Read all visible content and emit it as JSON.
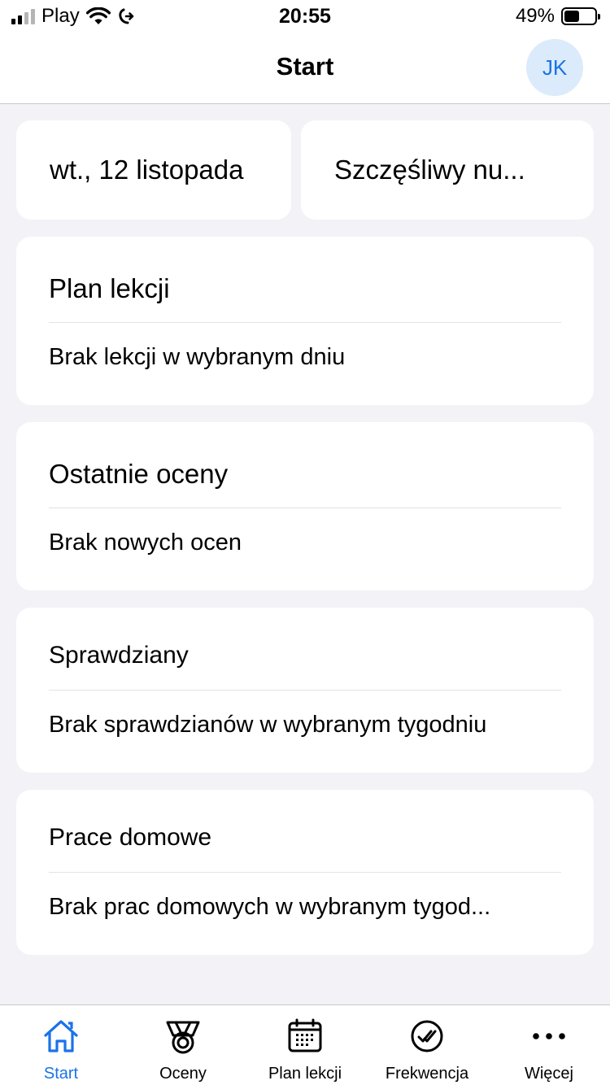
{
  "status_bar": {
    "carrier": "Play",
    "time": "20:55",
    "battery_percent": "49%",
    "battery_level": 0.49
  },
  "nav": {
    "title": "Start",
    "avatar_initials": "JK"
  },
  "summary": {
    "date": "wt., 12 listopada",
    "lucky_number": "Szczęśliwy nu..."
  },
  "cards": {
    "timetable": {
      "title": "Plan lekcji",
      "body": "Brak lekcji w wybranym dniu"
    },
    "grades": {
      "title": "Ostatnie oceny",
      "body": "Brak nowych ocen"
    },
    "exams": {
      "title": "Sprawdziany",
      "body": "Brak sprawdzianów w wybranym tygodniu"
    },
    "homework": {
      "title": "Prace domowe",
      "body": "Brak prac domowych w wybranym tygod..."
    }
  },
  "tabs": [
    {
      "label": "Start",
      "icon": "home-icon",
      "active": true
    },
    {
      "label": "Oceny",
      "icon": "medal-icon",
      "active": false
    },
    {
      "label": "Plan lekcji",
      "icon": "calendar-icon",
      "active": false
    },
    {
      "label": "Frekwencja",
      "icon": "check-circle-icon",
      "active": false
    },
    {
      "label": "Więcej",
      "icon": "more-icon",
      "active": false
    }
  ],
  "colors": {
    "accent": "#1a73e8",
    "background": "#f2f2f7",
    "avatar_bg": "#dcebfb"
  }
}
